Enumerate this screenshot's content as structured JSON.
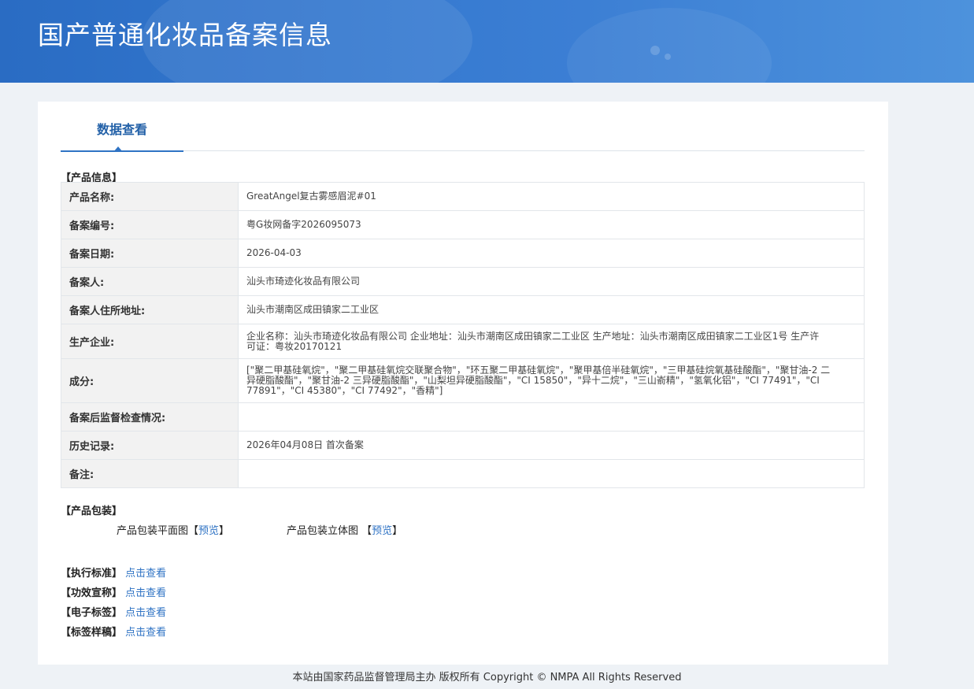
{
  "header": {
    "title": "国产普通化妆品备案信息"
  },
  "tab": {
    "label": "数据查看"
  },
  "product_info": {
    "section_label": "【产品信息】",
    "rows": [
      {
        "key": "产品名称:",
        "value": "GreatAngel复古雾感眉泥#01"
      },
      {
        "key": "备案编号:",
        "value": "粤G妆网备字2026095073"
      },
      {
        "key": "备案日期:",
        "value": "2026-04-03"
      },
      {
        "key": "备案人:",
        "value": "汕头市琦迹化妆品有限公司"
      },
      {
        "key": "备案人住所地址:",
        "value": "汕头市潮南区成田镇家二工业区"
      },
      {
        "key": "生产企业:",
        "value": "企业名称：汕头市琦迹化妆品有限公司 企业地址：汕头市潮南区成田镇家二工业区 生产地址：汕头市潮南区成田镇家二工业区1号 生产许可证：粤妆20170121"
      },
      {
        "key": "成分:",
        "value": "[\"聚二甲基硅氧烷\"，\"聚二甲基硅氧烷交联聚合物\"，\"环五聚二甲基硅氧烷\"，\"聚甲基倍半硅氧烷\"，\"三甲基硅烷氧基硅酸酯\"，\"聚甘油-2 二异硬脂酸酯\"，\"聚甘油-2 三异硬脂酸酯\"，\"山梨坦异硬脂酸酯\"，\"CI 15850\"，\"异十二烷\"，\"三山嵛精\"，\"氢氧化铝\"，\"CI 77491\"，\"CI 77891\"，\"CI 45380\"，\"CI 77492\"，\"香精\"]"
      },
      {
        "key": "备案后监督检查情况:",
        "value": ""
      },
      {
        "key": "历史记录:",
        "value": "2026年04月08日 首次备案"
      },
      {
        "key": "备注:",
        "value": ""
      }
    ]
  },
  "packaging": {
    "section_label": "【产品包装】",
    "flat_label": "产品包装平面图【",
    "flat_link": "预览",
    "flat_close": "】",
    "solid_label": "产品包装立体图 【",
    "solid_link": "预览",
    "solid_close": "】"
  },
  "links": [
    {
      "label": "【执行标准】",
      "link": "点击查看"
    },
    {
      "label": "【功效宣称】",
      "link": "点击查看"
    },
    {
      "label": "【电子标签】",
      "link": "点击查看"
    },
    {
      "label": "【标签样稿】",
      "link": "点击查看"
    }
  ],
  "footer": {
    "text": "本站由国家药品监督管理局主办 版权所有 Copyright © NMPA All Rights Reserved"
  }
}
